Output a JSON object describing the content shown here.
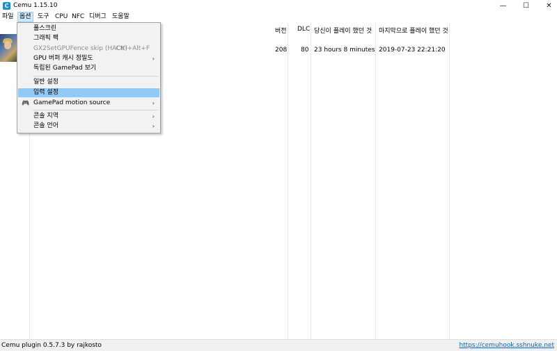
{
  "window": {
    "title": "Cemu 1.15.10",
    "app_icon": "C"
  },
  "menubar": {
    "items": [
      "파일",
      "옵션",
      "도구",
      "CPU",
      "NFC",
      "디버그",
      "도움말"
    ]
  },
  "list": {
    "columns": [
      "버전",
      "DLC",
      "당신이 플레이 했던 것",
      "마지막으로 플레이 했던 것"
    ],
    "rows": [
      {
        "version": "208",
        "dlc": "80",
        "played": "23 hours 8 minutes",
        "last_played": "2019-07-23 22:21:20"
      }
    ]
  },
  "dropdown": {
    "items": [
      {
        "label": "풀스크린"
      },
      {
        "label": "그래픽 팩"
      },
      {
        "label": "GX2SetGPUFence skip (HACK)",
        "shortcut": "Ctrl+Alt+F",
        "disabled": true
      },
      {
        "label": "GPU 버퍼 캐시 정밀도",
        "submenu": true
      },
      {
        "label": "독립된 GamePad 보기"
      },
      {
        "label": "일반 설정"
      },
      {
        "label": "입력 설정",
        "highlighted": true
      },
      {
        "label": "GamePad motion source",
        "submenu": true,
        "icon": "gamepad-icon"
      },
      {
        "label": "콘솔 지역",
        "submenu": true
      },
      {
        "label": "콘솔 언어",
        "submenu": true
      }
    ]
  },
  "statusbar": {
    "left": "Cemu plugin 0.5.7.3 by rajkosto",
    "link": "https://cemuhook.sshnuke.net"
  }
}
